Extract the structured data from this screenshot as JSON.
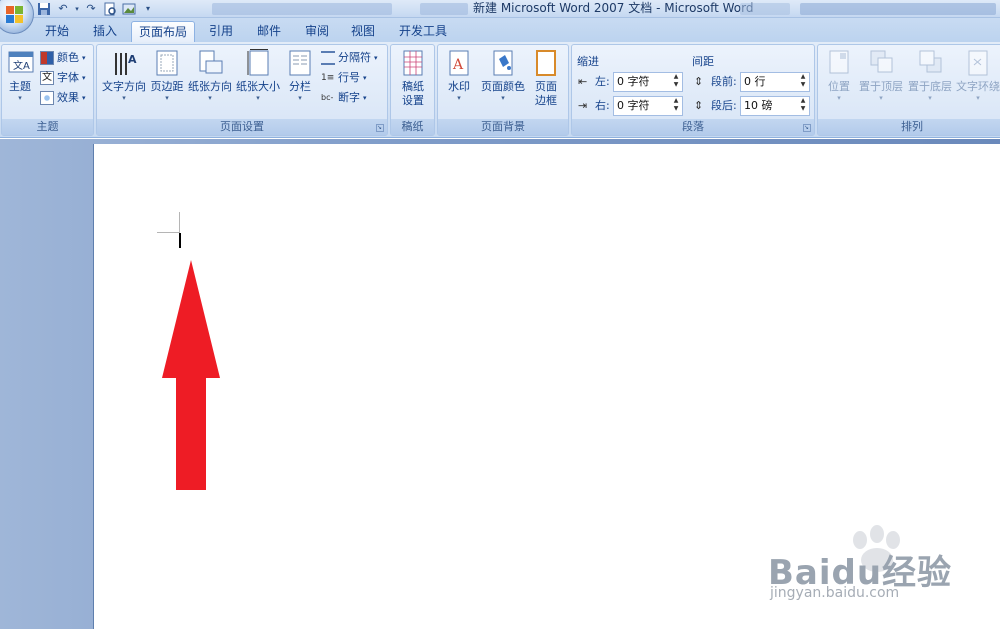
{
  "window": {
    "title": "新建 Microsoft Word 2007 文档 - Microsoft Word"
  },
  "quick_access": {
    "save": "save-icon",
    "undo": "undo-icon",
    "redo": "redo-icon",
    "print_preview": "print-preview-icon",
    "picture": "picture-icon",
    "customize": "▾"
  },
  "tabs": [
    "开始",
    "插入",
    "页面布局",
    "引用",
    "邮件",
    "审阅",
    "视图",
    "开发工具"
  ],
  "active_tab": "页面布局",
  "ribbon": {
    "theme_group": {
      "title": "主题",
      "theme_btn": "主题",
      "colors": "颜色",
      "fonts": "字体",
      "effects": "效果"
    },
    "page_setup_group": {
      "title": "页面设置",
      "text_direction": "文字方向",
      "margins": "页边距",
      "orientation": "纸张方向",
      "size": "纸张大小",
      "columns": "分栏",
      "breaks": "分隔符",
      "line_numbers": "行号",
      "hyphenation": "断字"
    },
    "draft_group": {
      "title": "稿纸",
      "draft_settings_l1": "稿纸",
      "draft_settings_l2": "设置"
    },
    "page_background_group": {
      "title": "页面背景",
      "watermark": "水印",
      "page_color": "页面颜色",
      "page_borders_l1": "页面",
      "page_borders_l2": "边框"
    },
    "paragraph_group": {
      "title": "段落",
      "indent_header": "缩进",
      "spacing_header": "间距",
      "indent_left_label": "左:",
      "indent_left_value": "0 字符",
      "indent_right_label": "右:",
      "indent_right_value": "0 字符",
      "spacing_before_label": "段前:",
      "spacing_before_value": "0 行",
      "spacing_after_label": "段后:",
      "spacing_after_value": "10 磅"
    },
    "arrange_group": {
      "title": "排列",
      "position": "位置",
      "bring_front": "置于顶层",
      "send_back": "置于底层",
      "text_wrap": "文字环绕"
    }
  },
  "watermark_overlay": {
    "brand": "Baidu经验",
    "url": "jingyan.baidu.com"
  },
  "colors": {
    "annotation_arrow": "#ee1c25",
    "ribbon_text": "#15428b"
  }
}
